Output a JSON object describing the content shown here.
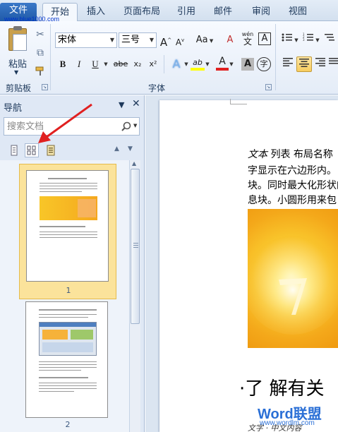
{
  "watermark_top": "www.blue1000.com",
  "tabs": [
    {
      "label": "文件"
    },
    {
      "label": "开始"
    },
    {
      "label": "插入"
    },
    {
      "label": "页面布局"
    },
    {
      "label": "引用"
    },
    {
      "label": "邮件"
    },
    {
      "label": "审阅"
    },
    {
      "label": "视图"
    }
  ],
  "clipboard": {
    "paste_label": "粘贴",
    "group_label": "剪贴板"
  },
  "font": {
    "name": "宋体",
    "size": "三号",
    "grow": "A",
    "shrink": "A",
    "change_case": "Aa",
    "clear_format": "A",
    "pinyin": "wén",
    "char_border": "A",
    "bold": "B",
    "italic": "I",
    "underline": "U",
    "strikethrough": "abe",
    "subscript": "x₂",
    "superscript": "x²",
    "text_effect": "A",
    "highlight": "ab",
    "font_color": "A",
    "char_shading": "A",
    "enclose_char": "字",
    "group_label": "字体"
  },
  "navigation": {
    "title": "导航",
    "search_placeholder": "搜索文档",
    "thumbnails": [
      {
        "page_number": "1"
      },
      {
        "page_number": "2"
      }
    ]
  },
  "document": {
    "line1_italic": "文本",
    "line1_rest": " 列表  布局名称",
    "line2": "字显示在六边形内。",
    "line3": "块。同时最大化形状的",
    "line4": "息块。小圆形用来包",
    "heading": "·了  解有关",
    "footer": "文字 · 中文内容"
  },
  "logo": {
    "brand": "Word联盟",
    "url": "www.wordlm.com"
  },
  "colors": {
    "file_tab": "#2b67b7",
    "ribbon": "#e4ecf7",
    "nav_pane": "#dfe8f5",
    "thumb_selected": "#fbe39b",
    "arrow": "#e02020",
    "accent": "#1e395b"
  }
}
